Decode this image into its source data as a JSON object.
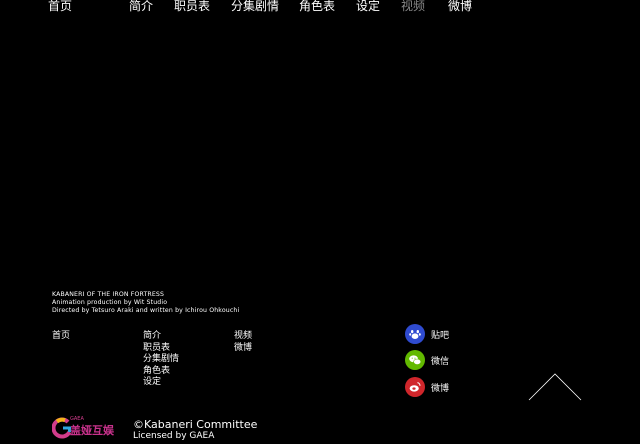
{
  "nav": {
    "items": [
      {
        "label": "首页"
      },
      {
        "label": "简介"
      },
      {
        "label": "职员表"
      },
      {
        "label": "分集剧情"
      },
      {
        "label": "角色表"
      },
      {
        "label": "设定"
      },
      {
        "label": "视频"
      },
      {
        "label": "微博"
      }
    ]
  },
  "credits": {
    "line1": "KABANERI OF THE IRON FORTRESS",
    "line2": "Animation production by Wit Studio",
    "line3": "Directed by Tetsuro Araki and written by Ichirou Ohkouchi"
  },
  "footer": {
    "col1": [
      "首页"
    ],
    "col2": [
      "简介",
      "职员表",
      "分集剧情",
      "角色表",
      "设定"
    ],
    "col3": [
      "视频",
      "微博"
    ]
  },
  "social": [
    {
      "label": "贴吧",
      "icon": "baidu-paw-icon",
      "color": "#2f4bd0"
    },
    {
      "label": "微信",
      "icon": "wechat-icon",
      "color": "#62b900"
    },
    {
      "label": "微博",
      "icon": "weibo-icon",
      "color": "#d0262b"
    }
  ],
  "logo": {
    "small_text": "GAEA",
    "brand_text": "盖娅互娱",
    "colors": [
      "#d23c8c",
      "#2fa8e0",
      "#f3b21b"
    ]
  },
  "copyright": "©Kabaneri Committee",
  "license": "Licensed by GAEA",
  "colors": {
    "background": "#000000",
    "text": "#ffffff",
    "nav_dim": "#8a8a8a"
  }
}
